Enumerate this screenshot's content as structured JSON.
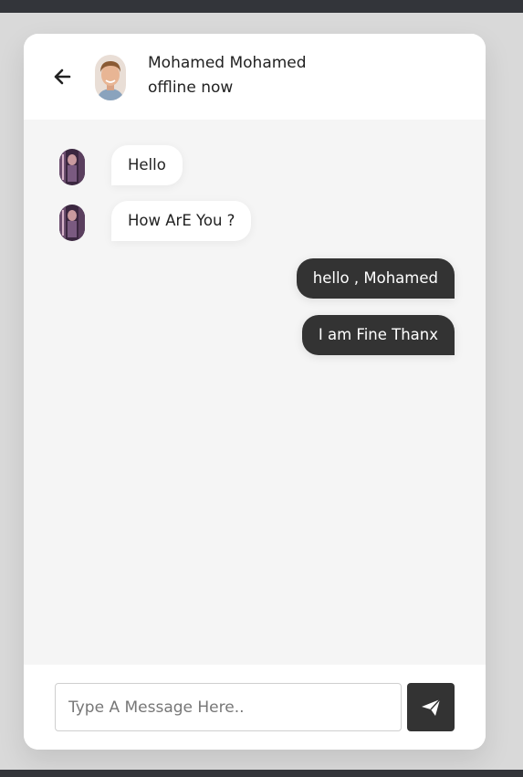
{
  "contact": {
    "name": "Mohamed Mohamed",
    "status": "offline now"
  },
  "icons": {
    "back": "arrow-left-icon",
    "send": "paper-plane-icon"
  },
  "colors": {
    "outgoing_bubble": "#333333",
    "incoming_bubble": "#ffffff",
    "chat_background": "#f5f5f5",
    "send_button": "#333333"
  },
  "messages": [
    {
      "direction": "incoming",
      "text": "Hello"
    },
    {
      "direction": "incoming",
      "text": "How ArE You ?"
    },
    {
      "direction": "outgoing",
      "text": "hello , Mohamed"
    },
    {
      "direction": "outgoing",
      "text": "I am Fine Thanx"
    }
  ],
  "composer": {
    "placeholder": "Type A Message Here..",
    "value": ""
  }
}
